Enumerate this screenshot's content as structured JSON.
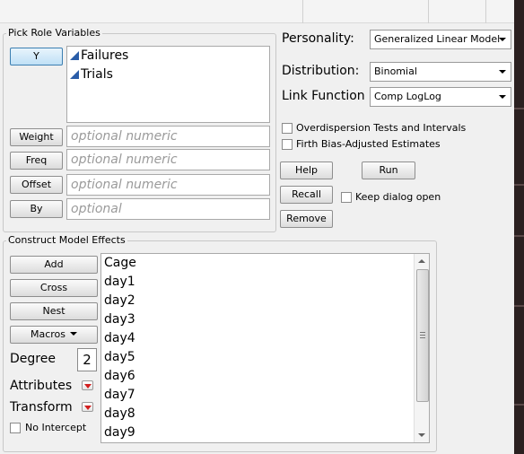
{
  "pick_role": {
    "title": "Pick Role Variables",
    "y_label": "Y",
    "y_vars": [
      "Failures",
      "Trials"
    ],
    "roles": [
      {
        "label": "Weight",
        "placeholder": "optional numeric"
      },
      {
        "label": "Freq",
        "placeholder": "optional numeric"
      },
      {
        "label": "Offset",
        "placeholder": "optional numeric"
      },
      {
        "label": "By",
        "placeholder": "optional"
      }
    ]
  },
  "settings": {
    "personality_label": "Personality:",
    "personality_value": "Generalized Linear Model",
    "distribution_label": "Distribution:",
    "distribution_value": "Binomial",
    "link_label": "Link Function",
    "link_value": "Comp LogLog",
    "overdispersion_label": "Overdispersion Tests and Intervals",
    "overdispersion_checked": false,
    "firth_label": "Firth Bias-Adjusted Estimates",
    "firth_checked": false
  },
  "actions": {
    "help": "Help",
    "run": "Run",
    "recall": "Recall",
    "remove": "Remove",
    "keep_open_label": "Keep dialog open",
    "keep_open_checked": false
  },
  "effects": {
    "title": "Construct Model Effects",
    "add": "Add",
    "cross": "Cross",
    "nest": "Nest",
    "macros": "Macros",
    "degree_label": "Degree",
    "degree_value": "2",
    "attributes_label": "Attributes",
    "transform_label": "Transform",
    "no_intercept_label": "No Intercept",
    "no_intercept_checked": false,
    "items": [
      "Cage",
      "day1",
      "day2",
      "day3",
      "day4",
      "day5",
      "day6",
      "day7",
      "day8",
      "day9"
    ]
  },
  "icons": {
    "continuous_var_icon": "blue-triangle",
    "dropdown_icon": "chevron-down",
    "red_menu_icon": "red-triangle"
  },
  "colors": {
    "accent": "#3c7fb1",
    "continuous_icon": "#2a5da8",
    "red_menu": "#d21e1e"
  }
}
